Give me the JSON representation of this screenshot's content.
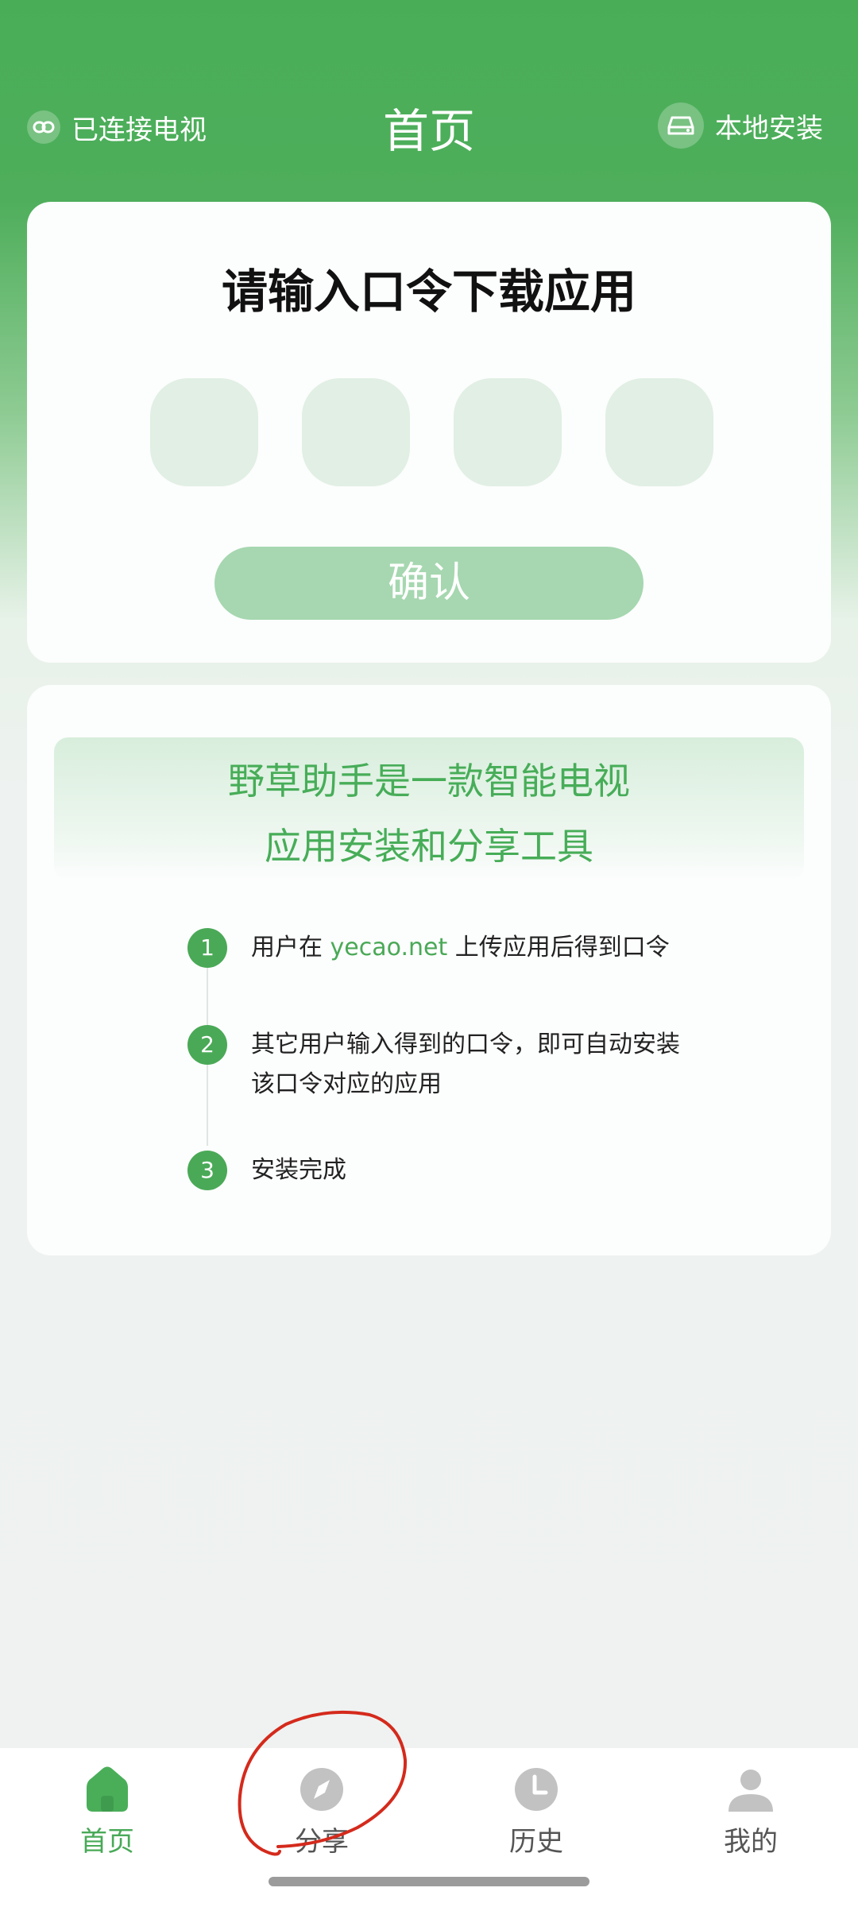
{
  "header": {
    "left_label": "已连接电视",
    "title": "首页",
    "right_label": "本地安装"
  },
  "code_card": {
    "title": "请输入口令下载应用",
    "confirm_label": "确认"
  },
  "intro_card": {
    "banner_line1": "野草助手是一款智能电视",
    "banner_line2": "应用安装和分享工具",
    "steps": [
      {
        "num": "1",
        "prefix": "用户在 ",
        "link": "yecao.net",
        "suffix": " 上传应用后得到口令"
      },
      {
        "num": "2",
        "text": "其它用户输入得到的口令，即可自动安装该口令对应的应用"
      },
      {
        "num": "3",
        "text": "安装完成"
      }
    ]
  },
  "tabbar": {
    "items": [
      {
        "label": "首页",
        "icon": "home-icon",
        "active": true
      },
      {
        "label": "分享",
        "icon": "compass-icon",
        "active": false
      },
      {
        "label": "历史",
        "icon": "clock-icon",
        "active": false
      },
      {
        "label": "我的",
        "icon": "user-icon",
        "active": false
      }
    ]
  },
  "colors": {
    "brand": "#49ad57",
    "annotation": "#d42a1c"
  }
}
